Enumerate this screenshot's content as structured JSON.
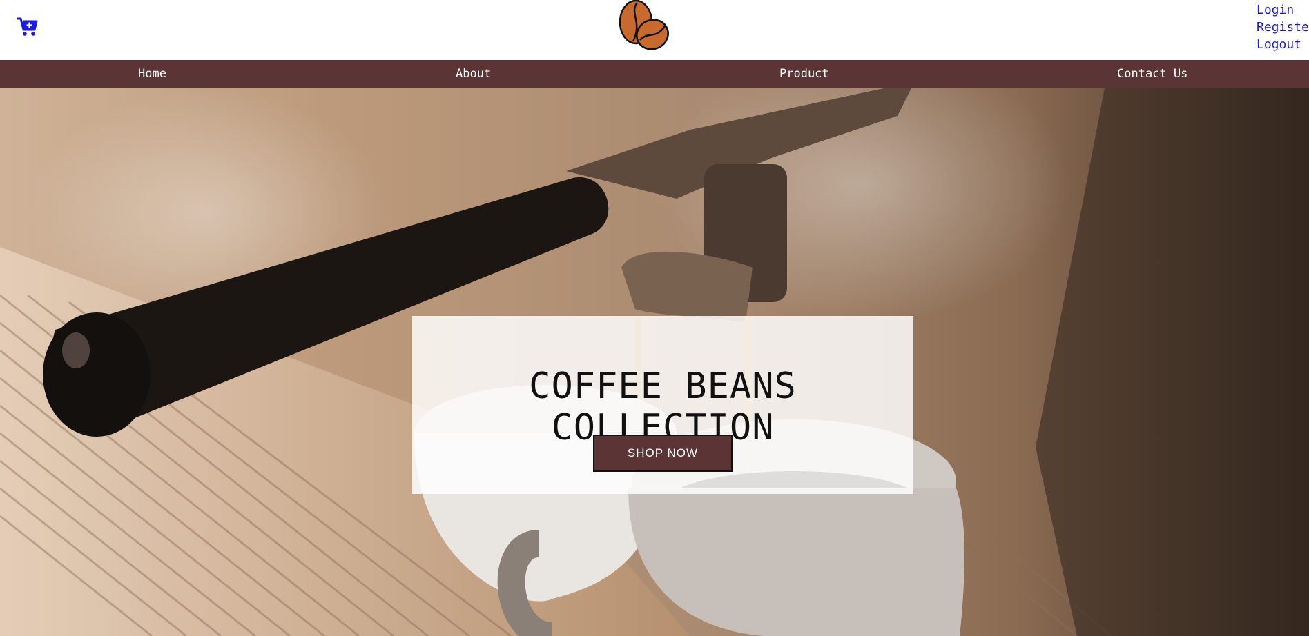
{
  "header": {
    "cart_icon": "cart-plus-icon",
    "logo_icon": "coffee-beans-logo",
    "auth_links": [
      "Login",
      "Register",
      "Logout"
    ]
  },
  "nav": {
    "items": [
      "Home",
      "About",
      "Product",
      "Contact Us"
    ]
  },
  "hero": {
    "title": "COFFEE BEANS COLLECTION",
    "button_label": "SHOP NOW"
  },
  "colors": {
    "nav_bg": "#5b3535",
    "link": "#1a1ae0",
    "logo_bean": "#c8692d"
  }
}
